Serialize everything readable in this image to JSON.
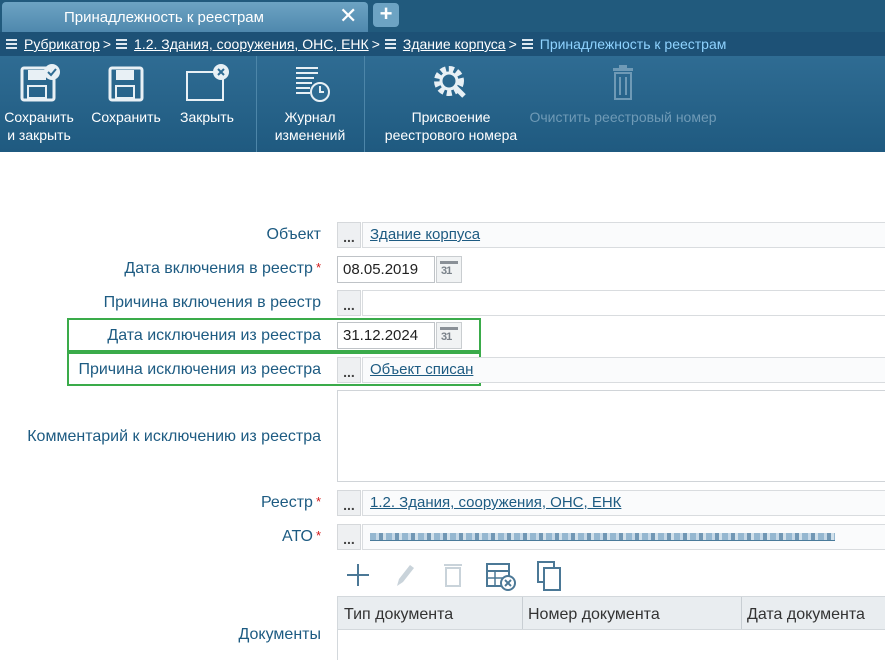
{
  "tab": {
    "title": "Принадлежность к реестрам",
    "close": "✕",
    "add": "+"
  },
  "breadcrumbs": [
    {
      "label": "Рубрикатор"
    },
    {
      "label": "1.2. Здания, сооружения, ОНС, ЕНК"
    },
    {
      "label": "Здание корпуса"
    },
    {
      "label": "Принадлежность к реестрам"
    }
  ],
  "breadcrumb_separator": ">",
  "toolbar": {
    "save_close": "Сохранить\nи закрыть",
    "save": "Сохранить",
    "close": "Закрыть",
    "journal": "Журнал\nизменений",
    "assign": "Присвоение\nреестрового номера",
    "clear": "Очистить реестровый номер"
  },
  "form": {
    "object_label": "Объект",
    "object_value": "Здание корпуса",
    "incl_date_label": "Дата включения в реестр",
    "incl_date_value": "08.05.2019",
    "incl_reason_label": "Причина включения в реестр",
    "excl_date_label": "Дата исключения из реестра",
    "excl_date_value": "31.12.2024",
    "excl_reason_label": "Причина исключения из реестра",
    "excl_reason_value": "Объект списан",
    "comment_label": "Комментарий к исключению из реестра",
    "registry_label": "Реестр",
    "registry_value": "1.2. Здания, сооружения, ОНС, ЕНК",
    "ato_label": "АТО",
    "documents_label": "Документы",
    "required_mark": "*",
    "dots": "...",
    "calendar": "31"
  },
  "documents": {
    "columns": [
      "Тип документа",
      "Номер документа",
      "Дата документа"
    ]
  },
  "colors": {
    "highlight": "#3aab4a",
    "label": "#1d5b82",
    "toolbar": "#2a6690"
  }
}
